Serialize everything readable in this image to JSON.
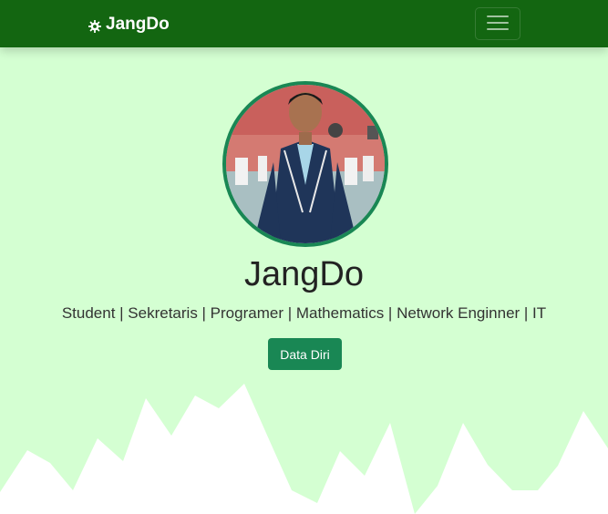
{
  "navbar": {
    "brand_label": "JangDo",
    "brand_icon": "gear-icon",
    "toggler_icon": "hamburger-menu-icon"
  },
  "hero": {
    "title": "JangDo",
    "subtitle": "Student | Sekretaris | Programer | Mathematics | Network Enginner | IT",
    "button_label": "Data Diri"
  },
  "colors": {
    "navbar_bg": "#136611",
    "page_bg": "#d4ffd2",
    "accent": "#198754",
    "wave": "#ffffff"
  }
}
